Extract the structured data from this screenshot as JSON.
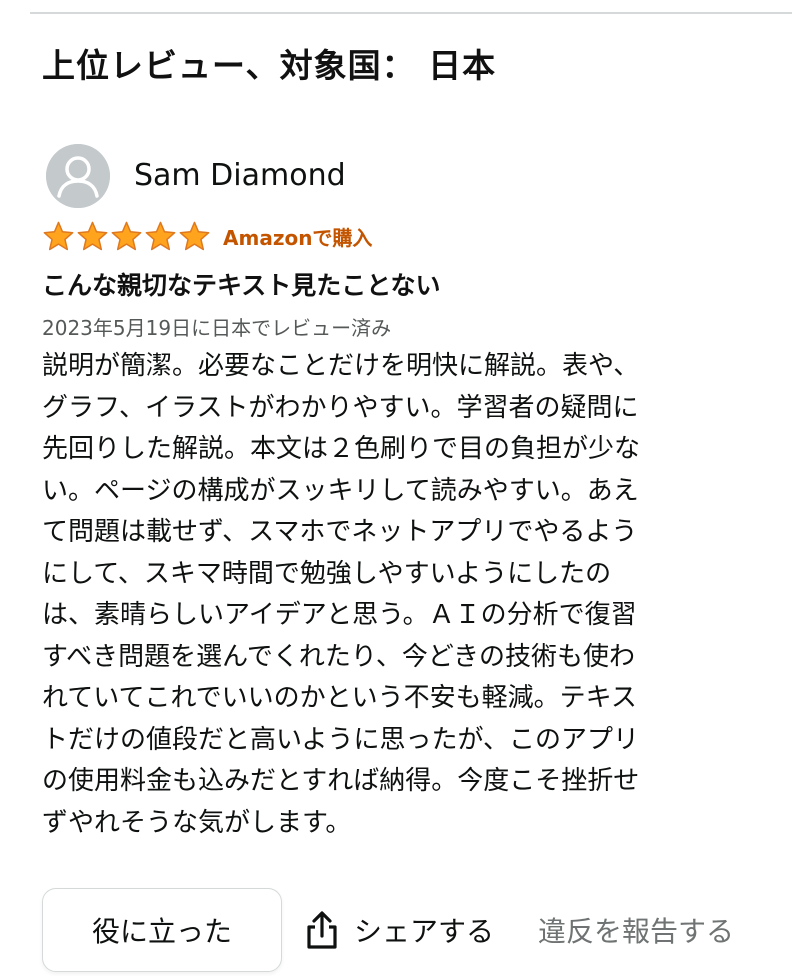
{
  "section": {
    "title": "上位レビュー、対象国： 日本"
  },
  "review": {
    "reviewer_name": "Sam Diamond",
    "rating": 5,
    "rating_max": 5,
    "star_color": "#ffa41c",
    "badge": "Amazonで購入",
    "badge_color": "#c45500",
    "title": "こんな親切なテキスト見たことない",
    "date": "2023年5月19日に日本でレビュー済み",
    "body_lines": [
      "説明が簡潔。必要なことだけを明快に解説。表や、",
      "グラフ、イラストがわかりやすい。学習者の疑問に",
      "先回りした解説。本文は２色刷りで目の負担が少な",
      "い。ページの構成がスッキリして読みやすい。あえ",
      "て問題は載せず、スマホでネットアプリでやるよう",
      "にして、スキマ時間で勉強しやすいようにしたの",
      "は、素晴らしいアイデアと思う。ＡＩの分析で復習",
      "すべき問題を選んでくれたり、今どきの技術も使わ",
      "れていてこれでいいのかという不安も軽減。テキス",
      "トだけの値段だと高いように思ったが、このアプリ",
      "の使用料金も込みだとすれば納得。今度こそ挫折せ",
      "ずやれそうな気がします。"
    ]
  },
  "actions": {
    "helpful_label": "役に立った",
    "share_label": "シェアする",
    "share_icon": "share-icon",
    "report_label": "違反を報告する"
  }
}
